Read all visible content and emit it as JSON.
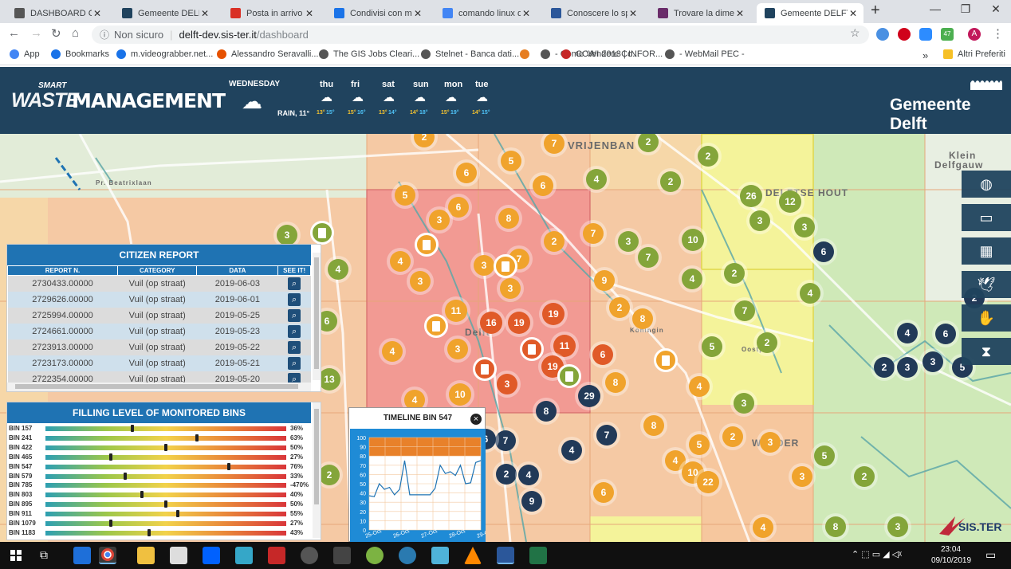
{
  "browser": {
    "tabs": [
      {
        "title": "DASHBOARD Cast",
        "icon": "gis-icon",
        "color": "#555"
      },
      {
        "title": "Gemeente DELFT",
        "icon": "delft-icon",
        "color": "#20435e"
      },
      {
        "title": "Posta in arrivo (2.2",
        "icon": "gmail-icon",
        "color": "#d93025"
      },
      {
        "title": "Condivisi con me",
        "icon": "drive-icon",
        "color": "#1a73e8"
      },
      {
        "title": "comando linux dir",
        "icon": "google-icon",
        "color": "#4285f4"
      },
      {
        "title": "Conoscere lo spazi",
        "icon": "word-icon",
        "color": "#2b579a"
      },
      {
        "title": "Trovare la dimensi",
        "icon": "site-icon",
        "color": "#6a2c6a"
      },
      {
        "title": "Gemeente DELFT",
        "icon": "delft-icon",
        "color": "#20435e"
      }
    ],
    "security": "Non sicuro",
    "url_host": "delft-dev.sis-ter.it",
    "url_path": "/dashboard",
    "ext_badge": "47",
    "profile": "A",
    "bookmarks": [
      "App",
      "Bookmarks",
      "m.videograbber.net...",
      "Alessandro Seravalli...",
      "The GIS Jobs Cleari...",
      "Stelnet - Banca dati...",
      "",
      "- Come Vendere Co...",
      "CCWI 2013 | INFOR...",
      "- WebMail PEC -"
    ],
    "more": "»",
    "other_bookmarks": "Altri Preferiti"
  },
  "header": {
    "logo_small": "SMART",
    "logo_waste": "WASTE",
    "logo_management": "MANAGEMENT",
    "today": "WEDNESDAY",
    "today_desc": "RAIN, 11°",
    "forecast": [
      {
        "day": "thu",
        "lo": "13°",
        "hi": "15°"
      },
      {
        "day": "fri",
        "lo": "15°",
        "hi": "16°"
      },
      {
        "day": "sat",
        "lo": "13°",
        "hi": "14°"
      },
      {
        "day": "sun",
        "lo": "14°",
        "hi": "18°"
      },
      {
        "day": "mon",
        "lo": "15°",
        "hi": "19°"
      },
      {
        "day": "tue",
        "lo": "14°",
        "hi": "15°"
      }
    ],
    "brand": "Gemeente Delft"
  },
  "map": {
    "labels": [
      {
        "t": "VRIJENBAN",
        "x": 712,
        "y": 175,
        "s": 13
      },
      {
        "t": "DELFTSE HOUT",
        "x": 960,
        "y": 235,
        "s": 12
      },
      {
        "t": "Klein",
        "x": 1190,
        "y": 188,
        "s": 12
      },
      {
        "t": "Delfgauw",
        "x": 1172,
        "y": 200,
        "s": 12
      },
      {
        "t": "WOLDER",
        "x": 943,
        "y": 549,
        "s": 12
      },
      {
        "t": "Delft",
        "x": 583,
        "y": 410,
        "s": 12
      },
      {
        "t": "Oostp",
        "x": 930,
        "y": 434,
        "s": 8
      },
      {
        "t": "Pr. Beatrixlaan",
        "x": 120,
        "y": 225,
        "s": 8
      },
      {
        "t": "Koningin",
        "x": 790,
        "y": 410,
        "s": 8
      }
    ],
    "markers": [
      {
        "v": "2",
        "c": "o",
        "x": 532,
        "y": 172
      },
      {
        "v": "7",
        "c": "o",
        "x": 695,
        "y": 180
      },
      {
        "v": "2",
        "c": "g",
        "x": 813,
        "y": 178
      },
      {
        "v": "2",
        "c": "g",
        "x": 888,
        "y": 196
      },
      {
        "v": "5",
        "c": "o",
        "x": 641,
        "y": 202
      },
      {
        "v": "6",
        "c": "o",
        "x": 585,
        "y": 217
      },
      {
        "v": "4",
        "c": "g",
        "x": 748,
        "y": 225
      },
      {
        "v": "2",
        "c": "g",
        "x": 841,
        "y": 228
      },
      {
        "v": "6",
        "c": "o",
        "x": 681,
        "y": 233
      },
      {
        "v": "5",
        "c": "o",
        "x": 508,
        "y": 245
      },
      {
        "v": "26",
        "c": "g",
        "x": 942,
        "y": 246
      },
      {
        "v": "12",
        "c": "g",
        "x": 991,
        "y": 253
      },
      {
        "v": "6",
        "c": "o",
        "x": 575,
        "y": 260
      },
      {
        "v": "8",
        "c": "o",
        "x": 638,
        "y": 274
      },
      {
        "v": "3",
        "c": "o",
        "x": 551,
        "y": 276
      },
      {
        "v": "3",
        "c": "g",
        "x": 953,
        "y": 277
      },
      {
        "v": "3",
        "c": "g",
        "x": 1009,
        "y": 285
      },
      {
        "v": "3",
        "c": "g",
        "x": 360,
        "y": 295
      },
      {
        "v": "7",
        "c": "o",
        "x": 744,
        "y": 293
      },
      {
        "v": "2",
        "c": "o",
        "x": 695,
        "y": 303
      },
      {
        "v": "3",
        "c": "g",
        "x": 788,
        "y": 303
      },
      {
        "v": "10",
        "c": "g",
        "x": 869,
        "y": 301
      },
      {
        "v": "6",
        "c": "n",
        "x": 1033,
        "y": 316
      },
      {
        "v": "7",
        "c": "g",
        "x": 813,
        "y": 323
      },
      {
        "v": "4",
        "c": "o",
        "x": 502,
        "y": 328
      },
      {
        "v": "3",
        "c": "o",
        "x": 607,
        "y": 333
      },
      {
        "v": "7",
        "c": "o",
        "x": 651,
        "y": 325
      },
      {
        "v": "4",
        "c": "g",
        "x": 424,
        "y": 338
      },
      {
        "v": "2",
        "c": "g",
        "x": 921,
        "y": 343
      },
      {
        "v": "4",
        "c": "g",
        "x": 868,
        "y": 350
      },
      {
        "v": "3",
        "c": "o",
        "x": 527,
        "y": 353
      },
      {
        "v": "9",
        "c": "o",
        "x": 758,
        "y": 352
      },
      {
        "v": "3",
        "c": "o",
        "x": 640,
        "y": 362
      },
      {
        "v": "4",
        "c": "g",
        "x": 1016,
        "y": 368
      },
      {
        "v": "2",
        "c": "n",
        "x": 1222,
        "y": 374
      },
      {
        "v": "2",
        "c": "o",
        "x": 777,
        "y": 386
      },
      {
        "v": "7",
        "c": "g",
        "x": 934,
        "y": 390
      },
      {
        "v": "11",
        "c": "o",
        "x": 572,
        "y": 390
      },
      {
        "v": "19",
        "c": "r",
        "x": 694,
        "y": 394
      },
      {
        "v": "8",
        "c": "o",
        "x": 806,
        "y": 400
      },
      {
        "v": "6",
        "c": "g",
        "x": 410,
        "y": 403
      },
      {
        "v": "16",
        "c": "r",
        "x": 616,
        "y": 405
      },
      {
        "v": "19",
        "c": "r",
        "x": 651,
        "y": 405
      },
      {
        "v": "4",
        "c": "n",
        "x": 1138,
        "y": 418
      },
      {
        "v": "6",
        "c": "n",
        "x": 1186,
        "y": 419
      },
      {
        "v": "2",
        "c": "g",
        "x": 962,
        "y": 430
      },
      {
        "v": "11",
        "c": "r",
        "x": 708,
        "y": 434
      },
      {
        "v": "5",
        "c": "g",
        "x": 893,
        "y": 435
      },
      {
        "v": "4",
        "c": "o",
        "x": 492,
        "y": 441
      },
      {
        "v": "3",
        "c": "o",
        "x": 574,
        "y": 438
      },
      {
        "v": "6",
        "c": "r",
        "x": 756,
        "y": 445
      },
      {
        "v": "3",
        "c": "n",
        "x": 1170,
        "y": 454
      },
      {
        "v": "2",
        "c": "n",
        "x": 1109,
        "y": 461
      },
      {
        "v": "3",
        "c": "n",
        "x": 1138,
        "y": 461
      },
      {
        "v": "5",
        "c": "n",
        "x": 1207,
        "y": 461
      },
      {
        "v": "19",
        "c": "r",
        "x": 693,
        "y": 460
      },
      {
        "v": "13",
        "c": "g",
        "x": 413,
        "y": 476
      },
      {
        "v": "3",
        "c": "r",
        "x": 636,
        "y": 482
      },
      {
        "v": "8",
        "c": "o",
        "x": 772,
        "y": 480
      },
      {
        "v": "4",
        "c": "o",
        "x": 877,
        "y": 485
      },
      {
        "v": "29",
        "c": "n",
        "x": 739,
        "y": 497
      },
      {
        "v": "10",
        "c": "o",
        "x": 577,
        "y": 495
      },
      {
        "v": "4",
        "c": "o",
        "x": 520,
        "y": 502
      },
      {
        "v": "3",
        "c": "g",
        "x": 933,
        "y": 506
      },
      {
        "v": "8",
        "c": "n",
        "x": 685,
        "y": 516
      },
      {
        "v": "8",
        "c": "o",
        "x": 820,
        "y": 534
      },
      {
        "v": "7",
        "c": "n",
        "x": 761,
        "y": 546
      },
      {
        "v": "2",
        "c": "o",
        "x": 919,
        "y": 548
      },
      {
        "v": "3",
        "c": "o",
        "x": 966,
        "y": 555
      },
      {
        "v": "7",
        "c": "n",
        "x": 634,
        "y": 553
      },
      {
        "v": "6",
        "c": "n",
        "x": 609,
        "y": 551
      },
      {
        "v": "5",
        "c": "o",
        "x": 877,
        "y": 558
      },
      {
        "v": "4",
        "c": "n",
        "x": 717,
        "y": 565
      },
      {
        "v": "5",
        "c": "g",
        "x": 1034,
        "y": 572
      },
      {
        "v": "4",
        "c": "o",
        "x": 847,
        "y": 578
      },
      {
        "v": "2",
        "c": "n",
        "x": 635,
        "y": 595
      },
      {
        "v": "4",
        "c": "n",
        "x": 663,
        "y": 596
      },
      {
        "v": "10",
        "c": "o",
        "x": 869,
        "y": 593
      },
      {
        "v": "3",
        "c": "o",
        "x": 1006,
        "y": 598
      },
      {
        "v": "2",
        "c": "g",
        "x": 1084,
        "y": 598
      },
      {
        "v": "2",
        "c": "g",
        "x": 413,
        "y": 596
      },
      {
        "v": "22",
        "c": "o",
        "x": 888,
        "y": 605
      },
      {
        "v": "6",
        "c": "o",
        "x": 757,
        "y": 618
      },
      {
        "v": "9",
        "c": "n",
        "x": 667,
        "y": 629
      },
      {
        "v": "4",
        "c": "o",
        "x": 957,
        "y": 662
      },
      {
        "v": "8",
        "c": "g",
        "x": 1048,
        "y": 661
      },
      {
        "v": "3",
        "c": "g",
        "x": 1126,
        "y": 661
      }
    ],
    "bins": [
      {
        "x": 404,
        "y": 292,
        "c": "#84a53a"
      },
      {
        "x": 535,
        "y": 307,
        "c": "#f0a32c"
      },
      {
        "x": 634,
        "y": 334,
        "c": "#f0a32c"
      },
      {
        "x": 547,
        "y": 409,
        "c": "#f0a32c"
      },
      {
        "x": 667,
        "y": 438,
        "c": "#e05a28"
      },
      {
        "x": 608,
        "y": 463,
        "c": "#e05a28"
      },
      {
        "x": 714,
        "y": 472,
        "c": "#84a53a"
      },
      {
        "x": 835,
        "y": 452,
        "c": "#f0a32c"
      }
    ]
  },
  "side_buttons": [
    "globe-icon",
    "layers-icon",
    "grid-icon",
    "bird-icon",
    "hand-icon",
    "hourglass-icon"
  ],
  "citizen_report": {
    "title": "CITIZEN REPORT",
    "columns": [
      "REPORT N.",
      "CATEGORY",
      "DATA",
      "SEE IT!"
    ],
    "rows": [
      [
        "2730433.00000",
        "Vuil (op straat)",
        "2019-06-03"
      ],
      [
        "2729626.00000",
        "Vuil (op straat)",
        "2019-06-01"
      ],
      [
        "2725994.00000",
        "Vuil (op straat)",
        "2019-05-25"
      ],
      [
        "2724661.00000",
        "Vuil (op straat)",
        "2019-05-23"
      ],
      [
        "2723913.00000",
        "Vuil (op straat)",
        "2019-05-22"
      ],
      [
        "2723173.00000",
        "Vuil (op straat)",
        "2019-05-21"
      ],
      [
        "2722354.00000",
        "Vuil (op straat)",
        "2019-05-20"
      ]
    ]
  },
  "filling": {
    "title": "FILLING LEVEL OF MONITORED BINS",
    "bins": [
      {
        "name": "BIN 157",
        "level": 36,
        "pct": "36%"
      },
      {
        "name": "BIN 241",
        "level": 63,
        "pct": "63%"
      },
      {
        "name": "BIN 422",
        "level": 50,
        "pct": "50%"
      },
      {
        "name": "BIN 465",
        "level": 27,
        "pct": "27%"
      },
      {
        "name": "BIN 547",
        "level": 76,
        "pct": "76%"
      },
      {
        "name": "BIN 579",
        "level": 33,
        "pct": "33%"
      },
      {
        "name": "BIN 785",
        "level": null,
        "pct": "-470%"
      },
      {
        "name": "BIN 803",
        "level": 40,
        "pct": "40%"
      },
      {
        "name": "BIN 895",
        "level": 50,
        "pct": "50%"
      },
      {
        "name": "BIN 911",
        "level": 55,
        "pct": "55%"
      },
      {
        "name": "BIN 1079",
        "level": 27,
        "pct": "27%"
      },
      {
        "name": "BIN 1183",
        "level": 43,
        "pct": "43%"
      }
    ]
  },
  "timeline": {
    "title": "TIMELINE BIN 547",
    "close": "×",
    "chart_data": {
      "type": "line",
      "ylim": [
        0,
        100
      ],
      "yticks": [
        100,
        90,
        80,
        70,
        60,
        50,
        40,
        30,
        20,
        10,
        0
      ],
      "xticks": [
        "25-Oct",
        "26-Oct",
        "27-Oct",
        "28-Oct",
        "29-Oct"
      ],
      "threshold_band": [
        80,
        100
      ],
      "series": [
        {
          "values": [
            37,
            36,
            50,
            44,
            46,
            38,
            44,
            75,
            38,
            38,
            38,
            38,
            38,
            45,
            70,
            61,
            63,
            59,
            70,
            50,
            51,
            73,
            75
          ]
        }
      ]
    }
  },
  "taskbar": {
    "time": "23:04",
    "date": "09/10/2019"
  }
}
